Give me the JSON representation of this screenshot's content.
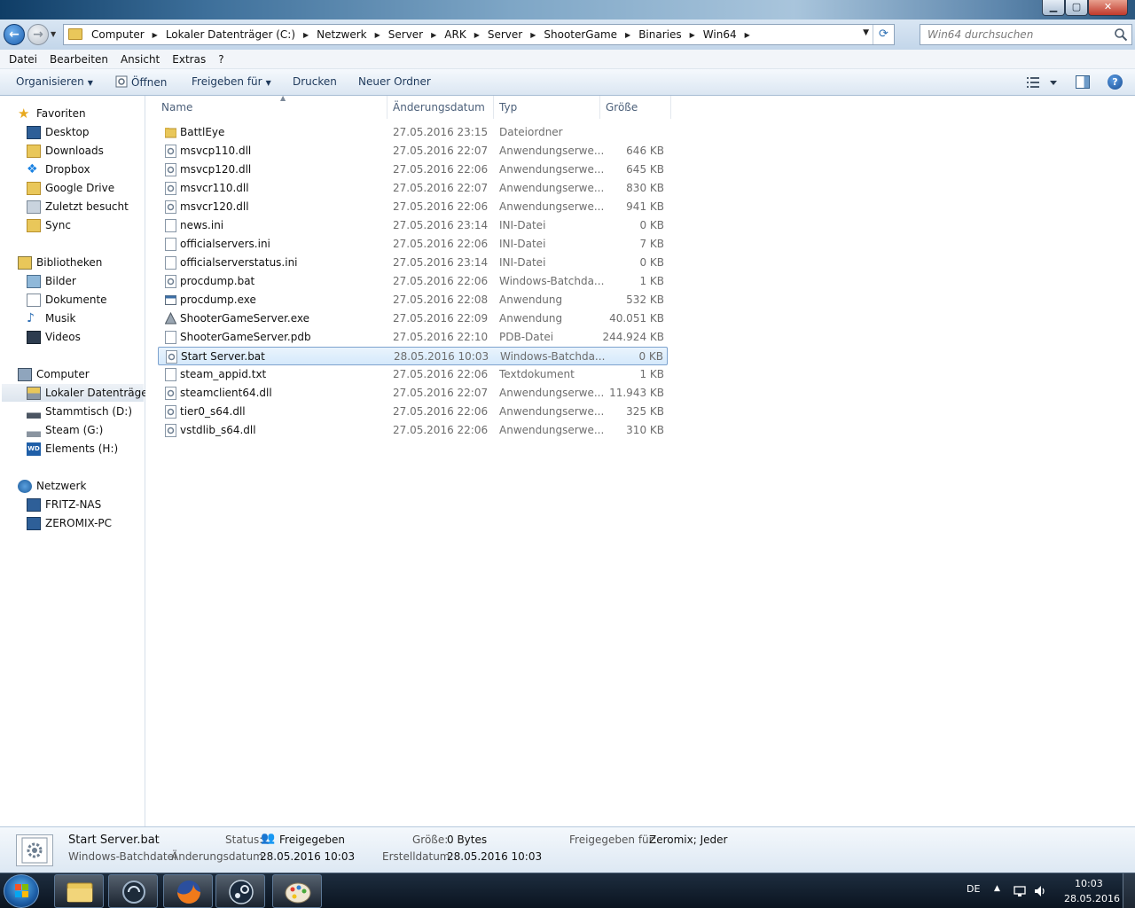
{
  "window": {
    "minimize_glyph": "▁",
    "maximize_glyph": "▢",
    "close_glyph": "✕"
  },
  "address": {
    "breadcrumb": [
      "Computer",
      "Lokaler Datenträger (C:)",
      "Netzwerk",
      "Server",
      "ARK",
      "Server",
      "ShooterGame",
      "Binaries",
      "Win64"
    ],
    "separator": "▶",
    "dropdown_glyph": "▼",
    "refresh_glyph": "⟳"
  },
  "search": {
    "placeholder": "Win64 durchsuchen"
  },
  "menu": [
    "Datei",
    "Bearbeiten",
    "Ansicht",
    "Extras",
    "?"
  ],
  "commands": {
    "organize": "Organisieren",
    "open": "Öffnen",
    "share": "Freigeben für",
    "print": "Drucken",
    "new_folder": "Neuer Ordner",
    "dropdown_glyph": "▼",
    "help": "?"
  },
  "nav": {
    "favorites": "Favoriten",
    "desktop": "Desktop",
    "downloads": "Downloads",
    "dropbox": "Dropbox",
    "google_drive": "Google Drive",
    "recent": "Zuletzt besucht",
    "sync": "Sync",
    "libraries": "Bibliotheken",
    "pictures": "Bilder",
    "documents": "Dokumente",
    "music": "Musik",
    "videos": "Videos",
    "computer": "Computer",
    "drive_c": "Lokaler Datenträger (",
    "drive_d": "Stammtisch (D:)",
    "drive_g": "Steam (G:)",
    "drive_h": "Elements (H:)",
    "network": "Netzwerk",
    "fritz_nas": "FRITZ-NAS",
    "zeromix_pc": "ZEROMIX-PC"
  },
  "columns": {
    "name": "Name",
    "date": "Änderungsdatum",
    "type": "Typ",
    "size": "Größe",
    "sort_glyph": "▲"
  },
  "files": [
    {
      "name": "BattlEye",
      "date": "27.05.2016 23:15",
      "type": "Dateiordner",
      "size": "",
      "kind": "folder"
    },
    {
      "name": "msvcp110.dll",
      "date": "27.05.2016 22:07",
      "type": "Anwendungserwe...",
      "size": "646 KB",
      "kind": "dll"
    },
    {
      "name": "msvcp120.dll",
      "date": "27.05.2016 22:06",
      "type": "Anwendungserwe...",
      "size": "645 KB",
      "kind": "dll"
    },
    {
      "name": "msvcr110.dll",
      "date": "27.05.2016 22:07",
      "type": "Anwendungserwe...",
      "size": "830 KB",
      "kind": "dll"
    },
    {
      "name": "msvcr120.dll",
      "date": "27.05.2016 22:06",
      "type": "Anwendungserwe...",
      "size": "941 KB",
      "kind": "dll"
    },
    {
      "name": "news.ini",
      "date": "27.05.2016 23:14",
      "type": "INI-Datei",
      "size": "0 KB",
      "kind": "ini"
    },
    {
      "name": "officialservers.ini",
      "date": "27.05.2016 22:06",
      "type": "INI-Datei",
      "size": "7 KB",
      "kind": "ini"
    },
    {
      "name": "officialserverstatus.ini",
      "date": "27.05.2016 23:14",
      "type": "INI-Datei",
      "size": "0 KB",
      "kind": "ini"
    },
    {
      "name": "procdump.bat",
      "date": "27.05.2016 22:06",
      "type": "Windows-Batchda...",
      "size": "1 KB",
      "kind": "bat"
    },
    {
      "name": "procdump.exe",
      "date": "27.05.2016 22:08",
      "type": "Anwendung",
      "size": "532 KB",
      "kind": "exe"
    },
    {
      "name": "ShooterGameServer.exe",
      "date": "27.05.2016 22:09",
      "type": "Anwendung",
      "size": "40.051 KB",
      "kind": "ark"
    },
    {
      "name": "ShooterGameServer.pdb",
      "date": "27.05.2016 22:10",
      "type": "PDB-Datei",
      "size": "244.924 KB",
      "kind": "ini"
    },
    {
      "name": "Start Server.bat",
      "date": "28.05.2016 10:03",
      "type": "Windows-Batchda...",
      "size": "0 KB",
      "kind": "bat",
      "selected": true
    },
    {
      "name": "steam_appid.txt",
      "date": "27.05.2016 22:06",
      "type": "Textdokument",
      "size": "1 KB",
      "kind": "txt"
    },
    {
      "name": "steamclient64.dll",
      "date": "27.05.2016 22:07",
      "type": "Anwendungserwe...",
      "size": "11.943 KB",
      "kind": "dll"
    },
    {
      "name": "tier0_s64.dll",
      "date": "27.05.2016 22:06",
      "type": "Anwendungserwe...",
      "size": "325 KB",
      "kind": "dll"
    },
    {
      "name": "vstdlib_s64.dll",
      "date": "27.05.2016 22:06",
      "type": "Anwendungserwe...",
      "size": "310 KB",
      "kind": "dll"
    }
  ],
  "details": {
    "filename": "Start Server.bat",
    "filetype": "Windows-Batchdatei",
    "status_label": "Status:",
    "status_value": "Freigegeben",
    "modified_label": "Änderungsdatum:",
    "modified_value": "28.05.2016 10:03",
    "size_label": "Größe:",
    "size_value": "0 Bytes",
    "created_label": "Erstelldatum:",
    "created_value": "28.05.2016 10:03",
    "shared_label": "Freigegeben für:",
    "shared_value": "Zeromix; Jeder"
  },
  "taskbar": {
    "language": "DE",
    "tray_arrow": "▲",
    "time": "10:03",
    "date": "28.05.2016"
  },
  "colors": {
    "accent": "#1c5fae",
    "selection_border": "#7da2ce",
    "folder": "#e9c75a"
  }
}
